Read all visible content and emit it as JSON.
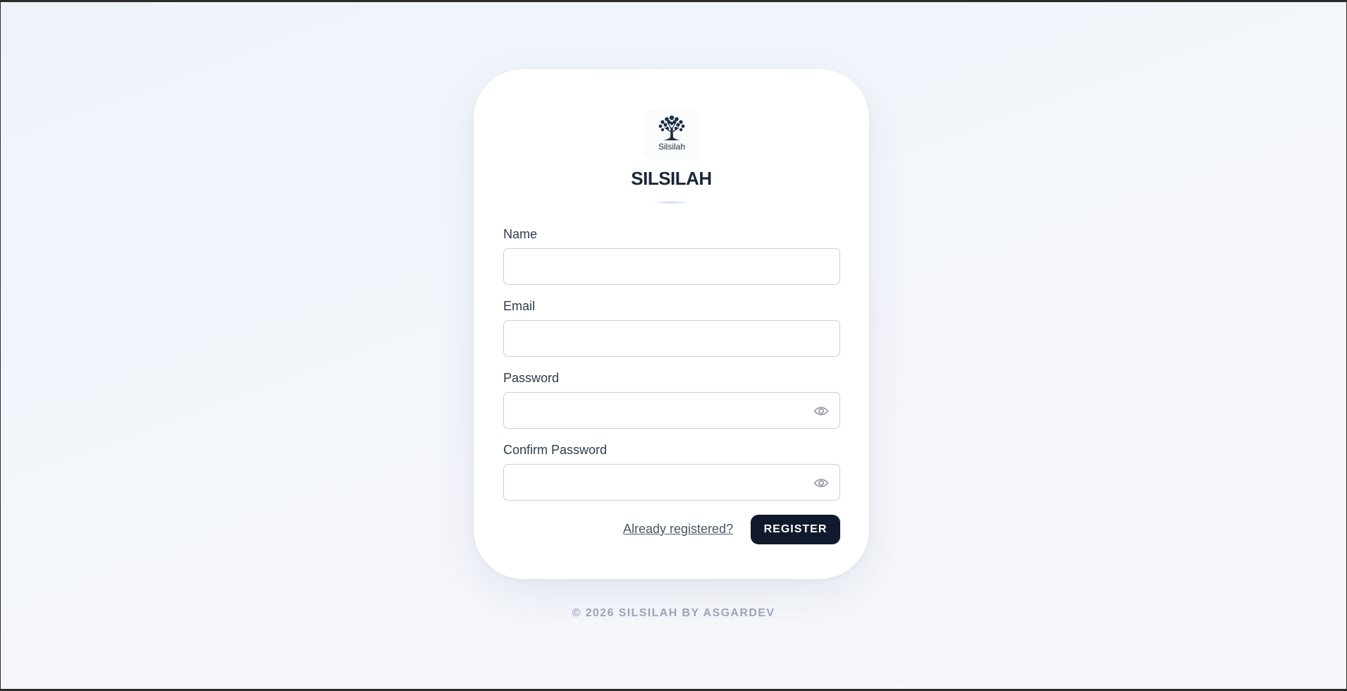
{
  "logo": {
    "text": "Silsilah",
    "icon": "tree-icon"
  },
  "brand": {
    "title": "SILSILAH"
  },
  "form": {
    "name": {
      "label": "Name",
      "value": "",
      "placeholder": ""
    },
    "email": {
      "label": "Email",
      "value": "",
      "placeholder": ""
    },
    "password": {
      "label": "Password",
      "value": "",
      "placeholder": "",
      "toggle_icon": "eye-icon"
    },
    "confirm_password": {
      "label": "Confirm Password",
      "value": "",
      "placeholder": "",
      "toggle_icon": "eye-icon"
    }
  },
  "actions": {
    "login_link": "Already registered?",
    "register_button": "REGISTER"
  },
  "footer": {
    "text": "© 2026 SILSILAH BY ASGARDEV"
  },
  "colors": {
    "primary_button": "#111a2c",
    "background": "#f3f6fb",
    "footer_text": "#9aa5b6"
  }
}
